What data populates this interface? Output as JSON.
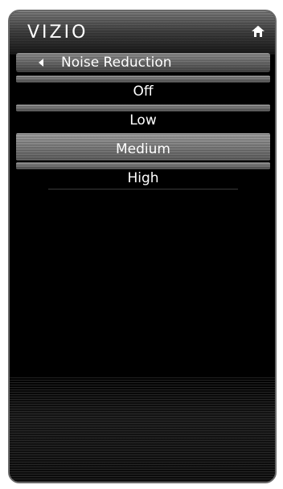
{
  "header": {
    "brand": "VIZIO",
    "home_icon": "home-icon"
  },
  "menu": {
    "back_icon": "back-arrow-icon",
    "title": "Noise Reduction",
    "options": [
      {
        "label": "Off",
        "selected": false
      },
      {
        "label": "Low",
        "selected": false
      },
      {
        "label": "Medium",
        "selected": true
      },
      {
        "label": "High",
        "selected": false
      }
    ]
  },
  "colors": {
    "background": "#000000",
    "text": "#ffffff",
    "highlight": "#8a8a8a"
  }
}
